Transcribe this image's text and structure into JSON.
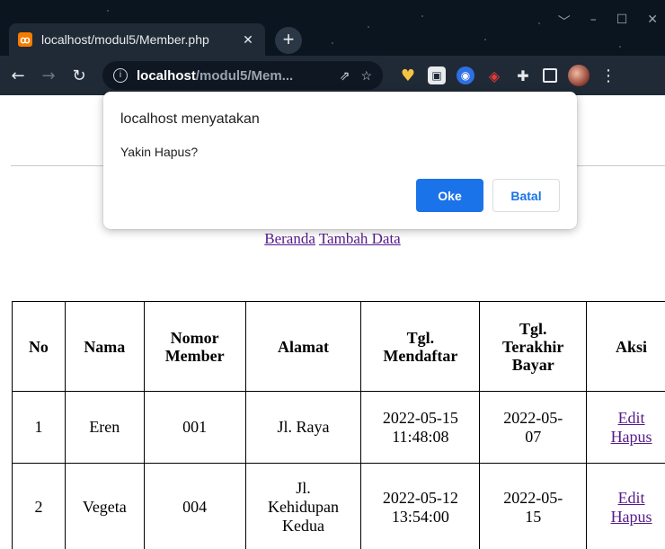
{
  "browser": {
    "tab_title": "localhost/modul5/Member.php",
    "tab_favicon": "xampp-icon",
    "tab_close": "✕",
    "new_tab": "+",
    "url_host": "localhost",
    "url_path": "/modul5/Mem...",
    "toolbar_icons": [
      "back-icon",
      "forward-icon",
      "reload-icon",
      "info-icon",
      "share-icon",
      "bookmark-star-icon"
    ],
    "extension_icons": [
      "heart-extension-icon",
      "box-extension-icon",
      "record-extension-icon",
      "red-extension-icon",
      "puzzle-icon",
      "side-panel-icon",
      "profile-avatar",
      "menu-icon"
    ]
  },
  "dialog": {
    "title": "localhost menyatakan",
    "message": "Yakin Hapus?",
    "ok_label": "Oke",
    "cancel_label": "Batal",
    "ok_color": "#1a73e8"
  },
  "nav_links": {
    "home": "Beranda",
    "add": "Tambah Data"
  },
  "table": {
    "headers": {
      "no": "No",
      "nama": "Nama",
      "nomor_a": "Nomor",
      "nomor_b": "Member",
      "alamat": "Alamat",
      "daftar_a": "Tgl.",
      "daftar_b": "Mendaftar",
      "bayar_a": "Tgl.",
      "bayar_b": "Terakhir",
      "bayar_c": "Bayar",
      "aksi": "Aksi"
    },
    "rows": [
      {
        "no": "1",
        "nama": "Eren",
        "nomor": "001",
        "alamat_a": "Jl. Raya",
        "daftar_a": "2022-05-15",
        "daftar_b": "11:48:08",
        "bayar_a": "2022-05-",
        "bayar_b": "07",
        "edit": "Edit",
        "hapus": "Hapus"
      },
      {
        "no": "2",
        "nama": "Vegeta",
        "nomor": "004",
        "alamat_a": "Jl.",
        "alamat_b": "Kehidupan",
        "alamat_c": "Kedua",
        "daftar_a": "2022-05-12",
        "daftar_b": "13:54:00",
        "bayar_a": "2022-05-",
        "bayar_b": "15",
        "edit": "Edit",
        "hapus": "Hapus"
      }
    ]
  }
}
